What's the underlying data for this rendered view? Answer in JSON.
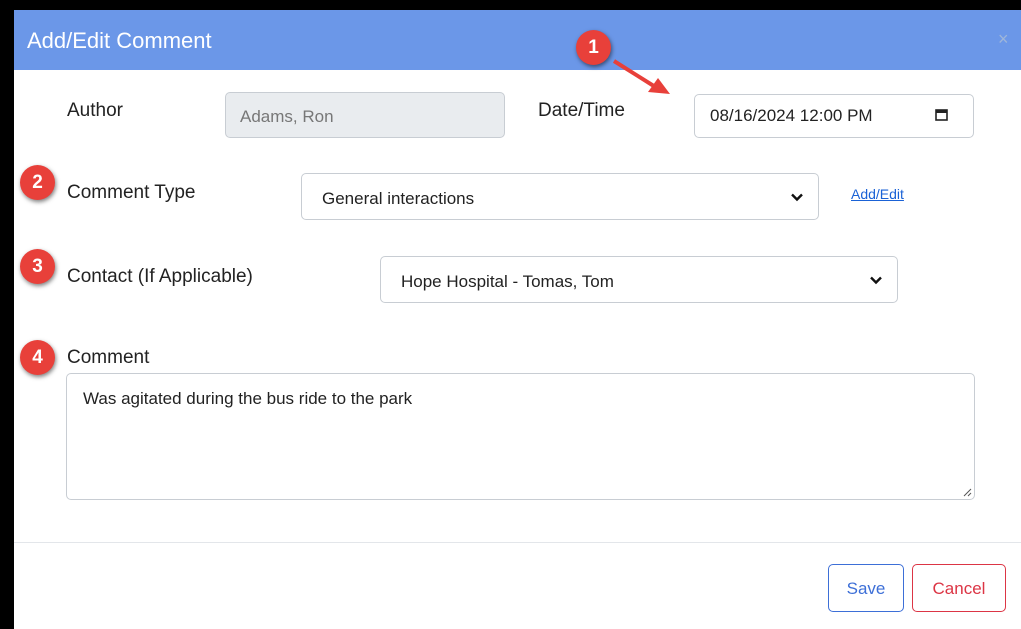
{
  "dialog": {
    "title": "Add/Edit Comment",
    "close_glyph": "×"
  },
  "form": {
    "author_label": "Author",
    "author_value": "Adams, Ron",
    "datetime_label": "Date/Time",
    "datetime_value": "08/16/2024 12:00 PM",
    "comment_type_label": "Comment Type",
    "comment_type_value": "General interactions",
    "add_edit_link": "Add/Edit",
    "contact_label": "Contact (If Applicable)",
    "contact_value": "Hope Hospital - Tomas, Tom",
    "comment_label": "Comment",
    "comment_value": "Was agitated during the bus ride to the park"
  },
  "buttons": {
    "save": "Save",
    "cancel": "Cancel"
  },
  "annotations": [
    "1",
    "2",
    "3",
    "4"
  ],
  "colors": {
    "titlebar": "#6b97e8",
    "badge": "#e8403a",
    "primary": "#3d6fd7",
    "danger": "#dc3545",
    "link": "#1a62d6"
  },
  "icons": {
    "calendar": "calendar-icon",
    "dropdown": "chevron-down-icon",
    "close": "close-icon",
    "resize": "resize-grip-icon",
    "arrow": "arrow-icon"
  }
}
